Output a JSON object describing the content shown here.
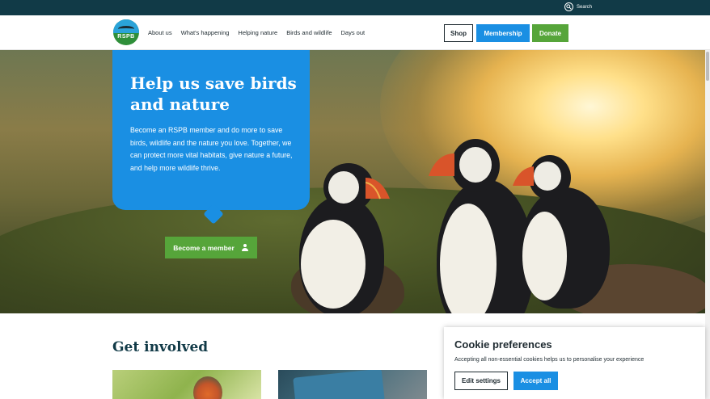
{
  "topbar": {
    "search_label": "Search"
  },
  "header": {
    "logo_text": "RSPB",
    "nav": [
      "About us",
      "What's happening",
      "Helping nature",
      "Birds and wildlife",
      "Days out"
    ],
    "shop_label": "Shop",
    "membership_label": "Membership",
    "donate_label": "Donate"
  },
  "hero": {
    "title": "Help us save birds and nature",
    "body": "Become an RSPB member and do more to save birds, wildlife and the nature you love. Together, we can protect more vital habitats, give nature a future, and help more wildlife thrive.",
    "cta_label": "Become a member"
  },
  "section": {
    "title": "Get involved"
  },
  "cookie": {
    "title": "Cookie preferences",
    "text": "Accepting all non-essential cookies helps us to personalise your experience",
    "edit_label": "Edit settings",
    "accept_label": "Accept all"
  },
  "colors": {
    "dark_teal": "#113a47",
    "brand_blue": "#1a8fe3",
    "brand_green": "#56a53a"
  },
  "icons": [
    "search-icon",
    "person-icon"
  ]
}
